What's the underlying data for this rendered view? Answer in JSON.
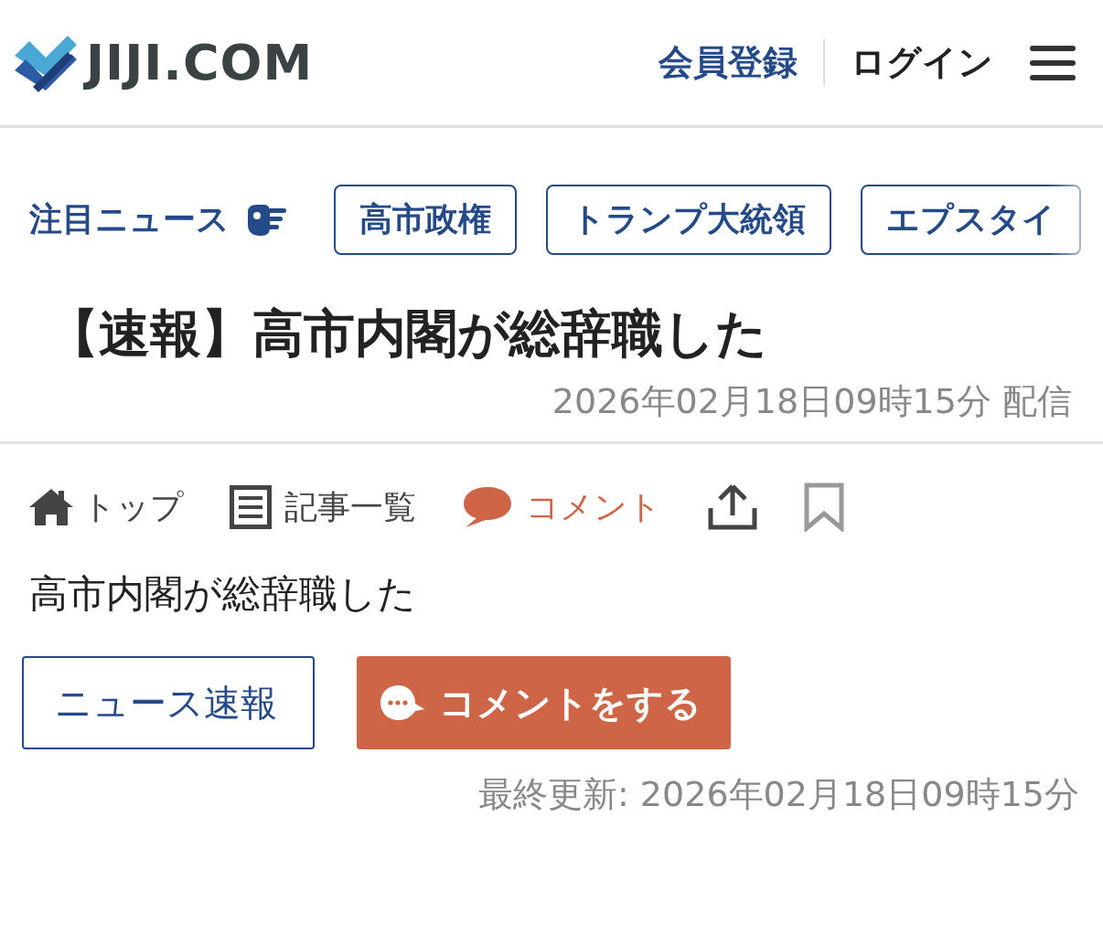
{
  "header": {
    "logo": "JIJI.COM",
    "links": [
      {
        "label": "会員登録",
        "kind": "register"
      },
      {
        "label": "ログイン",
        "kind": "login"
      }
    ]
  },
  "topics": {
    "label": "注目ニュース",
    "tags": [
      "高市政権",
      "トランプ大統領",
      "エプスタイ"
    ]
  },
  "article": {
    "headline": "【速報】高市内閣が総辞職した",
    "published": "2026年02月18日09時15分 配信",
    "tools": [
      {
        "kind": "home",
        "label": "トップ"
      },
      {
        "kind": "list",
        "label": "記事一覧"
      },
      {
        "kind": "comment",
        "label": "コメント"
      },
      {
        "kind": "share"
      },
      {
        "kind": "bookmark"
      }
    ],
    "body": "高市内閣が総辞職した",
    "buttons": [
      {
        "kind": "outline",
        "label": "ニュース速報"
      },
      {
        "kind": "comment",
        "label": "コメントをする"
      }
    ],
    "updated": "最終更新: 2026年02月18日09時15分"
  }
}
